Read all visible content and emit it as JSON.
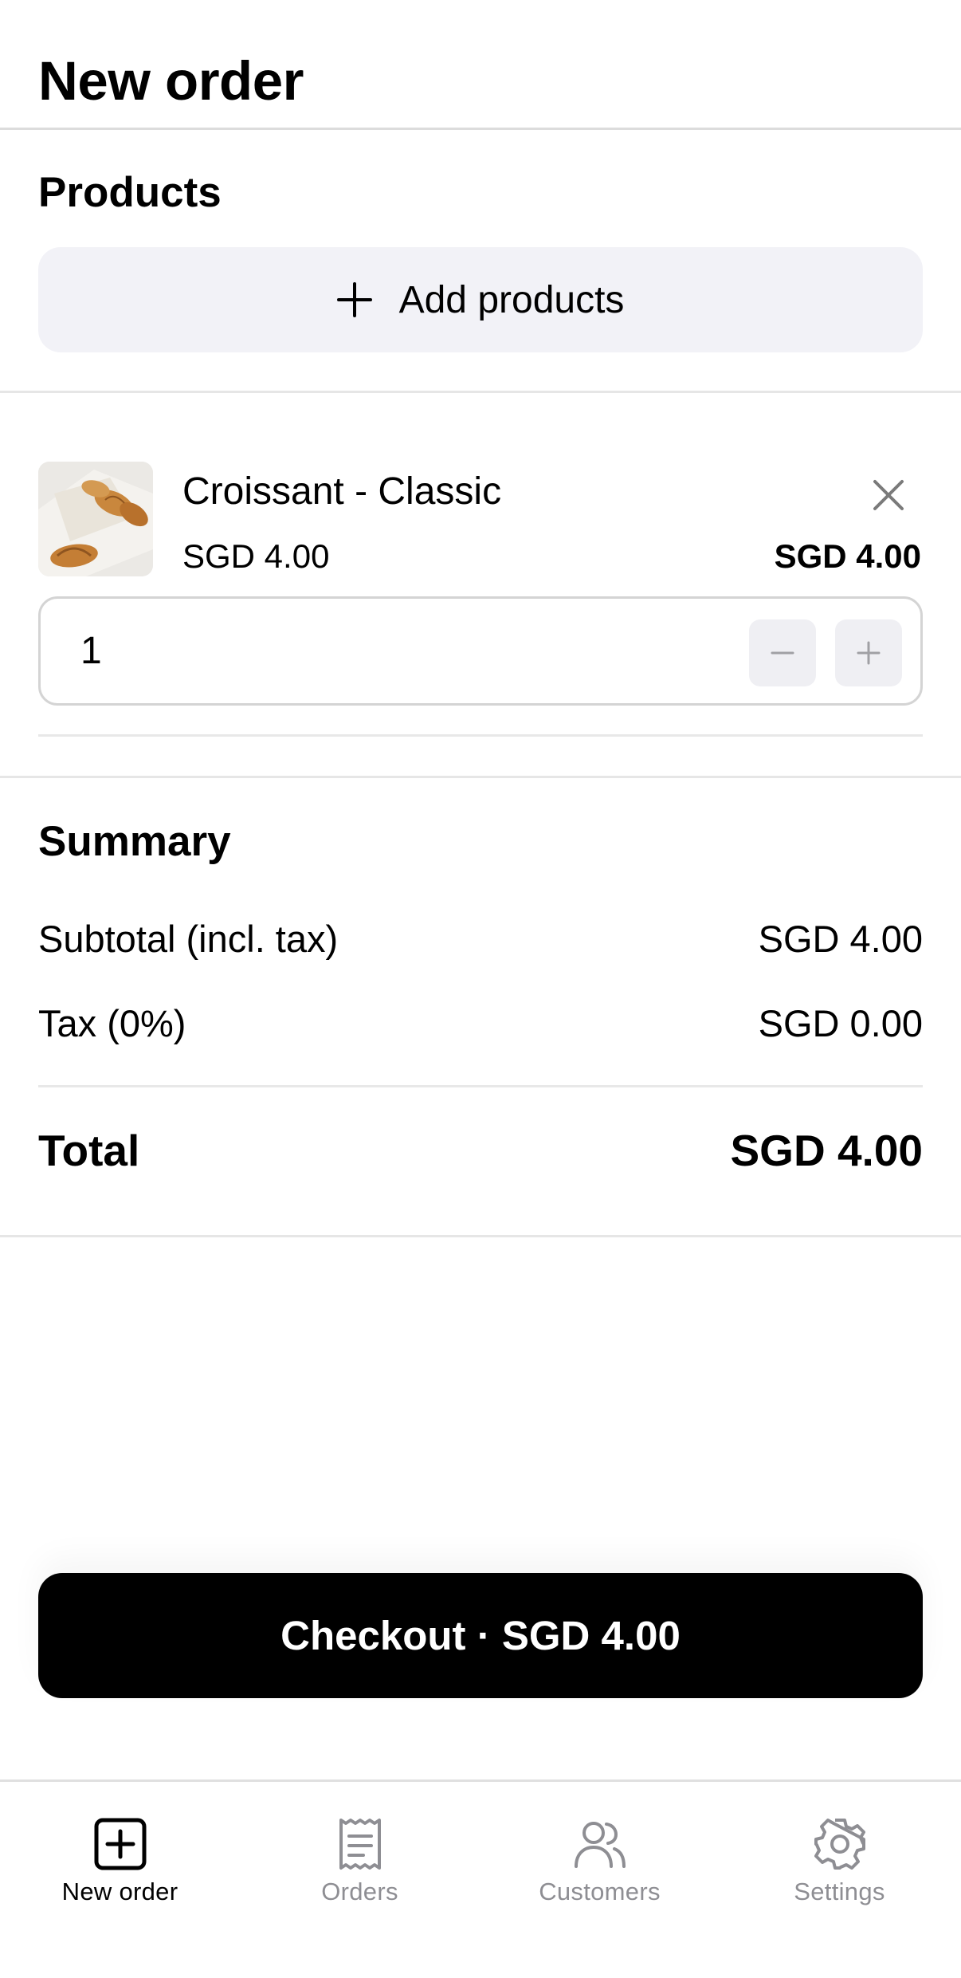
{
  "header": {
    "title": "New order"
  },
  "products": {
    "title": "Products",
    "add_label": "Add products",
    "items": [
      {
        "name": "Croissant - Classic",
        "unit_price": "SGD 4.00",
        "line_total": "SGD 4.00",
        "quantity": "1"
      }
    ]
  },
  "summary": {
    "title": "Summary",
    "subtotal_label": "Subtotal (incl. tax)",
    "subtotal_value": "SGD 4.00",
    "tax_label": "Tax (0%)",
    "tax_value": "SGD 0.00",
    "total_label": "Total",
    "total_value": "SGD 4.00"
  },
  "checkout": {
    "label": "Checkout · SGD 4.00"
  },
  "tabbar": {
    "tabs": [
      {
        "label": "New order",
        "icon": "plus-square-icon",
        "active": true
      },
      {
        "label": "Orders",
        "icon": "receipt-icon",
        "active": false
      },
      {
        "label": "Customers",
        "icon": "users-icon",
        "active": false
      },
      {
        "label": "Settings",
        "icon": "gear-icon",
        "active": false
      }
    ]
  },
  "colors": {
    "primary": "#000000",
    "muted": "#8e8e93",
    "button_bg": "#f2f2f7",
    "divider": "#e6e6e6"
  }
}
